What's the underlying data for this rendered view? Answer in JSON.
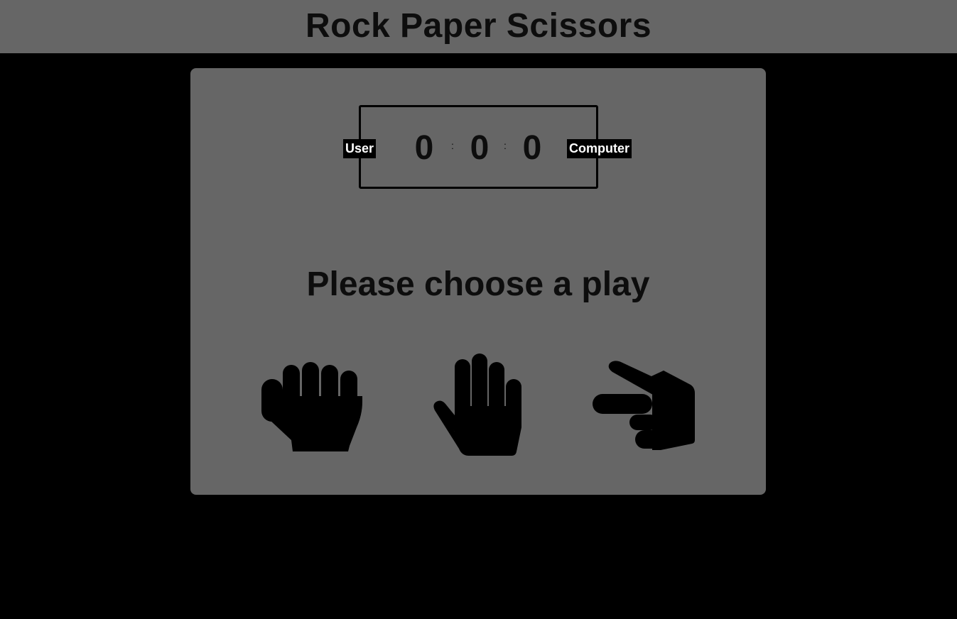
{
  "header": {
    "title": "Rock Paper Scissors"
  },
  "scoreboard": {
    "user_label": "User",
    "computer_label": "Computer",
    "user_score": "0",
    "ties": "0",
    "computer_score": "0",
    "separator": ":"
  },
  "game": {
    "prompt": "Please choose a play",
    "choices": [
      {
        "name": "rock",
        "icon": "hand-fist-icon"
      },
      {
        "name": "paper",
        "icon": "hand-open-icon"
      },
      {
        "name": "scissors",
        "icon": "hand-scissors-icon"
      }
    ]
  },
  "colors": {
    "page_background": "#000000",
    "panel": "#666666",
    "text": "#0d0d0d",
    "badge_background": "#000000",
    "badge_text": "#ffffff"
  }
}
